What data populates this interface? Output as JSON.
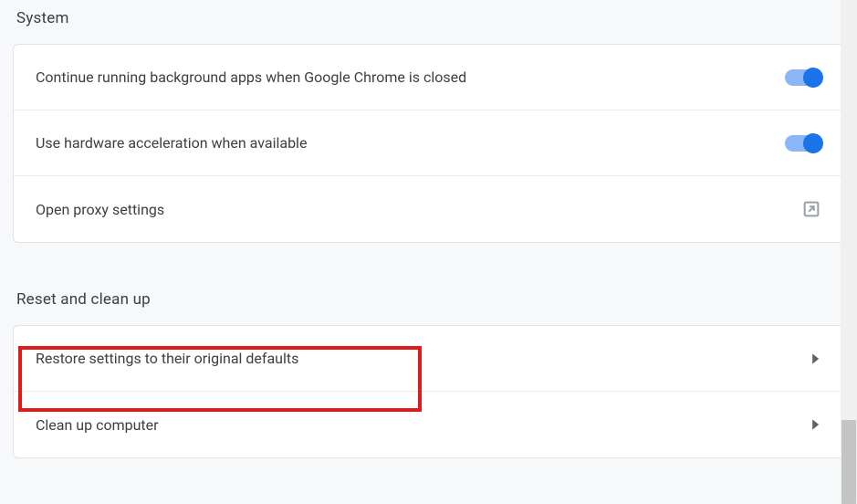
{
  "sections": {
    "system": {
      "title": "System",
      "rows": {
        "background_apps": {
          "label": "Continue running background apps when Google Chrome is closed",
          "toggle_on": true
        },
        "hardware_accel": {
          "label": "Use hardware acceleration when available",
          "toggle_on": true
        },
        "proxy": {
          "label": "Open proxy settings"
        }
      }
    },
    "reset": {
      "title": "Reset and clean up",
      "rows": {
        "restore_defaults": {
          "label": "Restore settings to their original defaults"
        },
        "clean_up": {
          "label": "Clean up computer"
        }
      }
    }
  },
  "colors": {
    "accent": "#1a73e8",
    "highlight": "#e21a1a"
  }
}
